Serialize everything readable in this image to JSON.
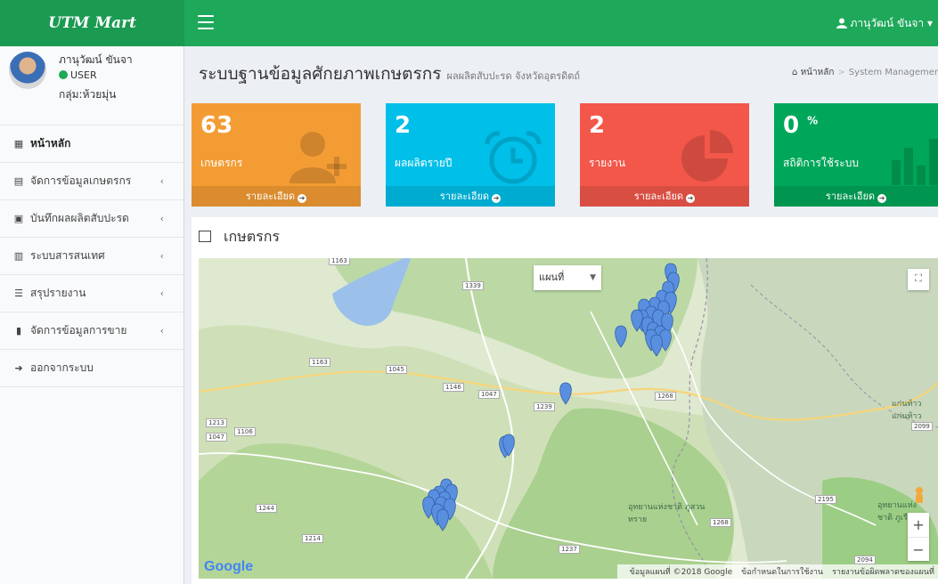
{
  "app": {
    "logo": "UTM Mart"
  },
  "topbar": {
    "user_name": "ภานุวัฒน์ ขันจา"
  },
  "sidebar": {
    "profile": {
      "name": "ภานุวัฒน์ ขันจา",
      "role": "USER",
      "group": "กลุ่ม:ห้วยมุ่น"
    },
    "items": [
      {
        "label": "หน้าหลัก",
        "icon": "dashboard-icon",
        "has_submenu": false
      },
      {
        "label": "จัดการข้อมูลเกษตรกร",
        "icon": "list-icon",
        "has_submenu": true
      },
      {
        "label": "บันทึกผลผลิตสับปะรด",
        "icon": "briefcase-icon",
        "has_submenu": true
      },
      {
        "label": "ระบบสารสนเทศ",
        "icon": "bar-chart-icon",
        "has_submenu": true
      },
      {
        "label": "สรุปรายงาน",
        "icon": "table-icon",
        "has_submenu": true
      },
      {
        "label": "จัดการข้อมูลการขาย",
        "icon": "file-icon",
        "has_submenu": true
      },
      {
        "label": "ออกจากระบบ",
        "icon": "sign-out-icon",
        "has_submenu": false
      }
    ]
  },
  "header": {
    "title": "ระบบฐานข้อมูลศักยภาพเกษตรกร",
    "subtitle": "ผลผลิตสับปะรด จังหวัดอุตรดิตถ์",
    "breadcrumb": [
      "หน้าหลัก",
      "System Managemer"
    ]
  },
  "stats": [
    {
      "value": "63",
      "label": "เกษตรกร",
      "link": "รายละเอียด",
      "color": "#f39c34",
      "icon": "user-add-icon"
    },
    {
      "value": "2",
      "label": "ผลผลิตรายปี",
      "link": "รายละเอียด",
      "color": "#00bfe8",
      "icon": "alarm-clock-icon"
    },
    {
      "value": "2",
      "label": "รายงาน",
      "link": "รายละเอียด",
      "color": "#f2574a",
      "icon": "pie-chart-icon"
    },
    {
      "value": "0",
      "unit": "%",
      "label": "สถิติการใช้ระบบ",
      "link": "รายละเอียด",
      "color": "#00a65a",
      "icon": "bar-chart-icon"
    }
  ],
  "panel": {
    "title": "เกษตรกร",
    "map": {
      "type_select": "แผนที่",
      "google_logo": "Google",
      "attribution": [
        "ข้อมูลแผนที่ ©2018 Google",
        "ข้อกำหนดในการใช้งาน",
        "รายงานข้อผิดพลาดของแผนที่"
      ],
      "road_labels": [
        "1163",
        "1339",
        "1163",
        "1045",
        "1146",
        "1047",
        "1239",
        "1268",
        "1213",
        "1047",
        "1106",
        "1244",
        "1214",
        "1237",
        "1268",
        "2195",
        "2094",
        "2099"
      ],
      "place_labels": [
        "อุทยานแห่งชาติ ภูสวนทราย",
        "อุทยานแห่งชาติ ภูเรือ",
        "แก่นท้าว แก่นท้าว"
      ],
      "marker_color": "#5a8fe0",
      "zoom": [
        "+",
        "−"
      ]
    }
  }
}
